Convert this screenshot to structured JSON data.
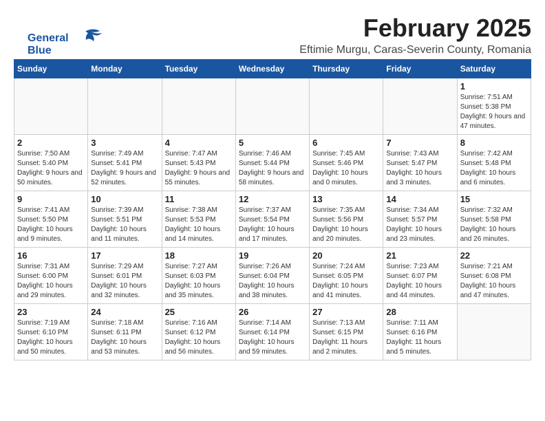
{
  "logo": {
    "line1": "General",
    "line2": "Blue"
  },
  "header": {
    "title": "February 2025",
    "subtitle": "Eftimie Murgu, Caras-Severin County, Romania"
  },
  "weekdays": [
    "Sunday",
    "Monday",
    "Tuesday",
    "Wednesday",
    "Thursday",
    "Friday",
    "Saturday"
  ],
  "weeks": [
    [
      {
        "day": "",
        "info": ""
      },
      {
        "day": "",
        "info": ""
      },
      {
        "day": "",
        "info": ""
      },
      {
        "day": "",
        "info": ""
      },
      {
        "day": "",
        "info": ""
      },
      {
        "day": "",
        "info": ""
      },
      {
        "day": "1",
        "info": "Sunrise: 7:51 AM\nSunset: 5:38 PM\nDaylight: 9 hours and 47 minutes."
      }
    ],
    [
      {
        "day": "2",
        "info": "Sunrise: 7:50 AM\nSunset: 5:40 PM\nDaylight: 9 hours and 50 minutes."
      },
      {
        "day": "3",
        "info": "Sunrise: 7:49 AM\nSunset: 5:41 PM\nDaylight: 9 hours and 52 minutes."
      },
      {
        "day": "4",
        "info": "Sunrise: 7:47 AM\nSunset: 5:43 PM\nDaylight: 9 hours and 55 minutes."
      },
      {
        "day": "5",
        "info": "Sunrise: 7:46 AM\nSunset: 5:44 PM\nDaylight: 9 hours and 58 minutes."
      },
      {
        "day": "6",
        "info": "Sunrise: 7:45 AM\nSunset: 5:46 PM\nDaylight: 10 hours and 0 minutes."
      },
      {
        "day": "7",
        "info": "Sunrise: 7:43 AM\nSunset: 5:47 PM\nDaylight: 10 hours and 3 minutes."
      },
      {
        "day": "8",
        "info": "Sunrise: 7:42 AM\nSunset: 5:48 PM\nDaylight: 10 hours and 6 minutes."
      }
    ],
    [
      {
        "day": "9",
        "info": "Sunrise: 7:41 AM\nSunset: 5:50 PM\nDaylight: 10 hours and 9 minutes."
      },
      {
        "day": "10",
        "info": "Sunrise: 7:39 AM\nSunset: 5:51 PM\nDaylight: 10 hours and 11 minutes."
      },
      {
        "day": "11",
        "info": "Sunrise: 7:38 AM\nSunset: 5:53 PM\nDaylight: 10 hours and 14 minutes."
      },
      {
        "day": "12",
        "info": "Sunrise: 7:37 AM\nSunset: 5:54 PM\nDaylight: 10 hours and 17 minutes."
      },
      {
        "day": "13",
        "info": "Sunrise: 7:35 AM\nSunset: 5:56 PM\nDaylight: 10 hours and 20 minutes."
      },
      {
        "day": "14",
        "info": "Sunrise: 7:34 AM\nSunset: 5:57 PM\nDaylight: 10 hours and 23 minutes."
      },
      {
        "day": "15",
        "info": "Sunrise: 7:32 AM\nSunset: 5:58 PM\nDaylight: 10 hours and 26 minutes."
      }
    ],
    [
      {
        "day": "16",
        "info": "Sunrise: 7:31 AM\nSunset: 6:00 PM\nDaylight: 10 hours and 29 minutes."
      },
      {
        "day": "17",
        "info": "Sunrise: 7:29 AM\nSunset: 6:01 PM\nDaylight: 10 hours and 32 minutes."
      },
      {
        "day": "18",
        "info": "Sunrise: 7:27 AM\nSunset: 6:03 PM\nDaylight: 10 hours and 35 minutes."
      },
      {
        "day": "19",
        "info": "Sunrise: 7:26 AM\nSunset: 6:04 PM\nDaylight: 10 hours and 38 minutes."
      },
      {
        "day": "20",
        "info": "Sunrise: 7:24 AM\nSunset: 6:05 PM\nDaylight: 10 hours and 41 minutes."
      },
      {
        "day": "21",
        "info": "Sunrise: 7:23 AM\nSunset: 6:07 PM\nDaylight: 10 hours and 44 minutes."
      },
      {
        "day": "22",
        "info": "Sunrise: 7:21 AM\nSunset: 6:08 PM\nDaylight: 10 hours and 47 minutes."
      }
    ],
    [
      {
        "day": "23",
        "info": "Sunrise: 7:19 AM\nSunset: 6:10 PM\nDaylight: 10 hours and 50 minutes."
      },
      {
        "day": "24",
        "info": "Sunrise: 7:18 AM\nSunset: 6:11 PM\nDaylight: 10 hours and 53 minutes."
      },
      {
        "day": "25",
        "info": "Sunrise: 7:16 AM\nSunset: 6:12 PM\nDaylight: 10 hours and 56 minutes."
      },
      {
        "day": "26",
        "info": "Sunrise: 7:14 AM\nSunset: 6:14 PM\nDaylight: 10 hours and 59 minutes."
      },
      {
        "day": "27",
        "info": "Sunrise: 7:13 AM\nSunset: 6:15 PM\nDaylight: 11 hours and 2 minutes."
      },
      {
        "day": "28",
        "info": "Sunrise: 7:11 AM\nSunset: 6:16 PM\nDaylight: 11 hours and 5 minutes."
      },
      {
        "day": "",
        "info": ""
      }
    ]
  ]
}
